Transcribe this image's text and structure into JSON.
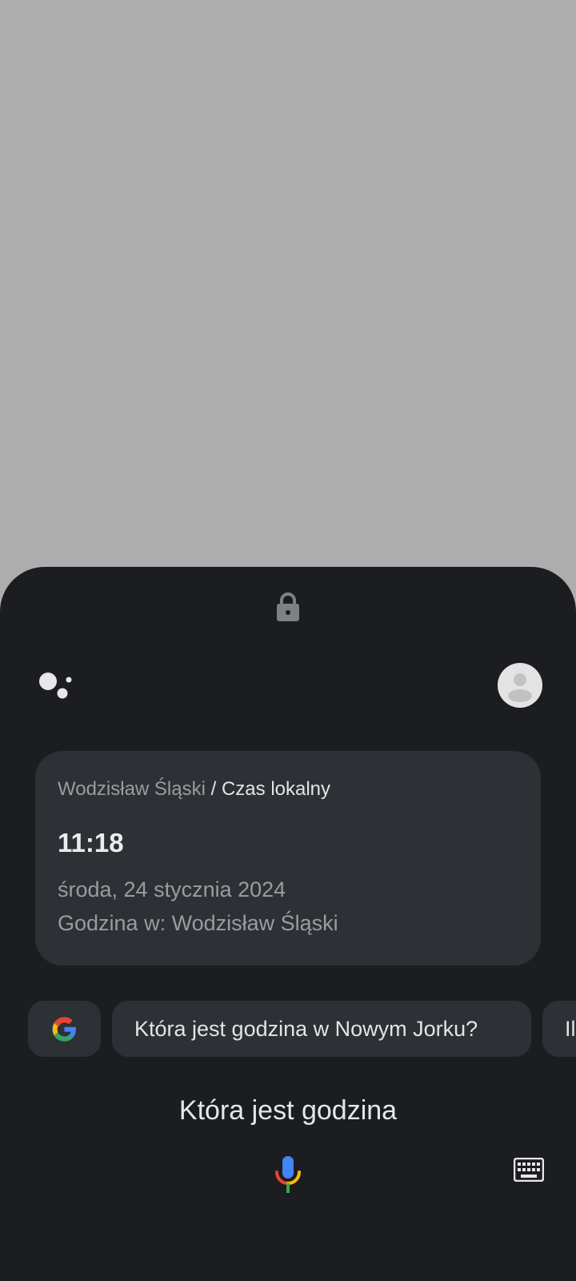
{
  "card": {
    "location": "Wodzisław Śląski",
    "separator": " / ",
    "category": "Czas lokalny",
    "time": "11:18",
    "date": "środa, 24 stycznia 2024",
    "place_line": "Godzina w: Wodzisław Śląski"
  },
  "suggestions": [
    {
      "label": "Która jest godzina w Nowym Jorku?"
    },
    {
      "label": "Il"
    }
  ],
  "query_text": "Która jest godzina",
  "icons": {
    "lock": "lock-icon",
    "assistant": "assistant-logo-icon",
    "avatar": "account-avatar-icon",
    "google": "google-g-icon",
    "mic": "microphone-icon",
    "keyboard": "keyboard-icon"
  },
  "colors": {
    "scrim": "#adadad",
    "sheet": "#1b1d20",
    "card": "#2d3034",
    "google_blue": "#4285F4",
    "google_red": "#EA4335",
    "google_yellow": "#FBBC05",
    "google_green": "#34A853"
  }
}
